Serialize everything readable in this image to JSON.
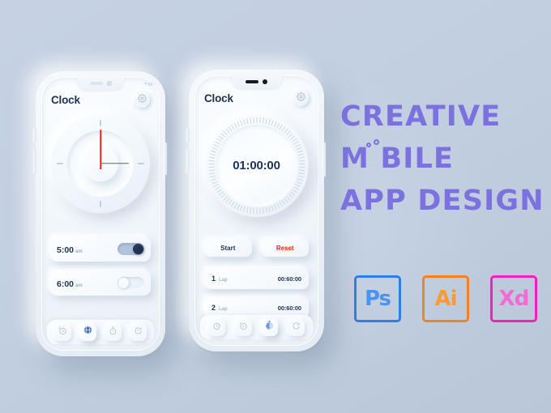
{
  "background_color": "#c4d1e2",
  "accent_purple": "#7b72e0",
  "headline": {
    "line1": "CREATIVE",
    "line2": "M BILE",
    "line2_full": "MOBILE",
    "line3": "APP DESIGN"
  },
  "badges": [
    {
      "id": "photoshop",
      "label": "Ps",
      "color": "#2f7ee8"
    },
    {
      "id": "illustrator",
      "label": "Ai",
      "color": "#f58220"
    },
    {
      "id": "xd",
      "label": "Xd",
      "color": "#f321b6"
    }
  ],
  "phone_alarm": {
    "status_bar": {
      "carrier": ""
    },
    "header": {
      "title": "Clock",
      "settings_icon": "gear-icon"
    },
    "clock": {
      "hour_marks": [
        "12",
        "3",
        "6",
        "9"
      ],
      "minute_hand_angle_deg": 0,
      "second_hand_angle_deg": 0,
      "second_hand_color": "#f0231f",
      "minute_hand_color": "#5d6673"
    },
    "alarms": [
      {
        "time": "5:00",
        "meridiem": "am",
        "enabled": true
      },
      {
        "time": "6:00",
        "meridiem": "am",
        "enabled": false
      }
    ],
    "nav": [
      {
        "id": "alarm",
        "icon": "alarm-clock-icon",
        "active": false
      },
      {
        "id": "world-clock",
        "icon": "globe-clock-icon",
        "active": true
      },
      {
        "id": "stopwatch",
        "icon": "stopwatch-icon",
        "active": false
      },
      {
        "id": "timer",
        "icon": "timer-icon",
        "active": false
      }
    ]
  },
  "phone_stopwatch": {
    "header": {
      "title": "Clock",
      "settings_icon": "gear-icon"
    },
    "dial": {
      "time": "01:00:00",
      "tick_count": 90
    },
    "controls": [
      {
        "id": "start",
        "label": "Start",
        "color": "#1f3354"
      },
      {
        "id": "reset",
        "label": "Reset",
        "color": "#f0231f"
      }
    ],
    "laps": [
      {
        "number": "1",
        "label": "Lap",
        "time": "00:60:00"
      },
      {
        "number": "2",
        "label": "Lap",
        "time": "00:60:00"
      }
    ],
    "nav": [
      {
        "id": "alarm",
        "icon": "alarm-clock-icon",
        "active": false
      },
      {
        "id": "world-clock",
        "icon": "globe-clock-icon",
        "active": false
      },
      {
        "id": "stopwatch",
        "icon": "stopwatch-icon",
        "active": true
      },
      {
        "id": "timer",
        "icon": "timer-icon",
        "active": false
      }
    ]
  }
}
